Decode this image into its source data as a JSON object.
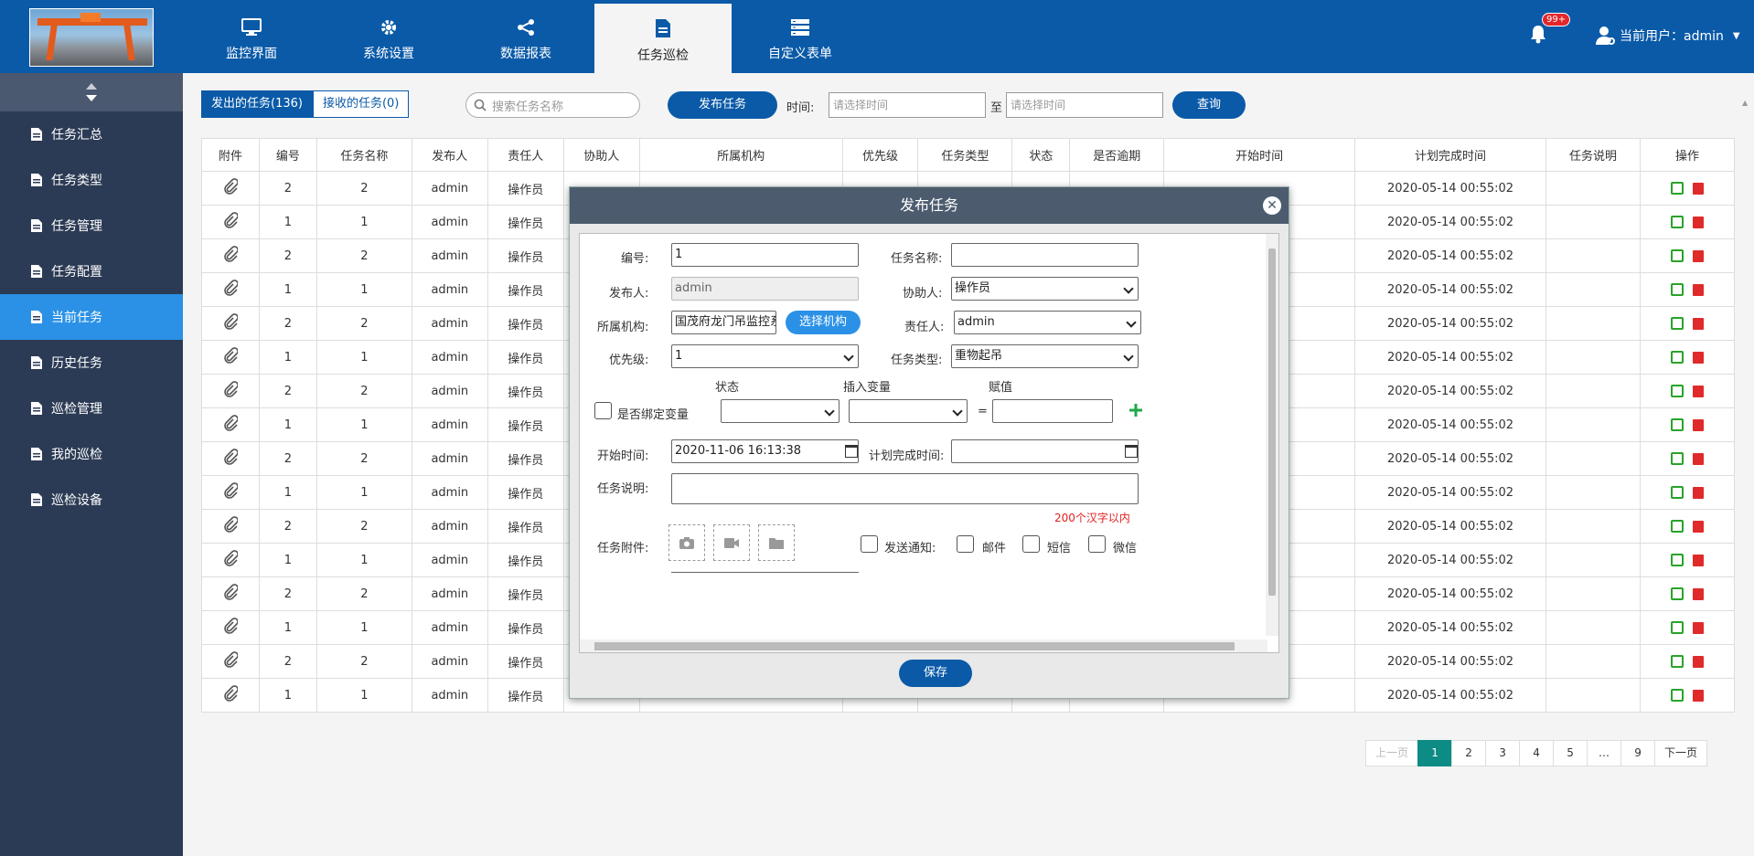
{
  "header": {
    "nav": [
      {
        "label": "监控界面",
        "icon": "monitor-icon"
      },
      {
        "label": "系统设置",
        "icon": "gear-icon"
      },
      {
        "label": "数据报表",
        "icon": "share-icon"
      },
      {
        "label": "任务巡检",
        "icon": "document-icon",
        "active": true
      },
      {
        "label": "自定义表单",
        "icon": "form-icon"
      }
    ],
    "badge": "99+",
    "user_label": "当前用户：admin"
  },
  "sidebar": {
    "items": [
      {
        "label": "任务汇总"
      },
      {
        "label": "任务类型"
      },
      {
        "label": "任务管理"
      },
      {
        "label": "任务配置"
      },
      {
        "label": "当前任务",
        "active": true
      },
      {
        "label": "历史任务"
      },
      {
        "label": "巡检管理"
      },
      {
        "label": "我的巡检"
      },
      {
        "label": "巡检设备"
      }
    ]
  },
  "toolbar": {
    "tab_sent": "发出的任务(136)",
    "tab_received": "接收的任务(0)",
    "search_placeholder": "搜索任务名称",
    "publish_label": "发布任务",
    "time_label": "时间:",
    "start_placeholder": "请选择时间",
    "to_label": "至",
    "end_placeholder": "请选择时间",
    "query_label": "查询"
  },
  "table": {
    "columns": [
      "附件",
      "编号",
      "任务名称",
      "发布人",
      "责任人",
      "协助人",
      "所属机构",
      "优先级",
      "任务类型",
      "状态",
      "是否逾期",
      "开始时间",
      "计划完成时间",
      "任务说明",
      "操作"
    ],
    "rows": [
      {
        "id": "2",
        "name": "2",
        "publisher": "admin",
        "owner": "操作员",
        "end": "2020-05-14 00:55:02"
      },
      {
        "id": "1",
        "name": "1",
        "publisher": "admin",
        "owner": "操作员",
        "end": "2020-05-14 00:55:02"
      },
      {
        "id": "2",
        "name": "2",
        "publisher": "admin",
        "owner": "操作员",
        "end": "2020-05-14 00:55:02"
      },
      {
        "id": "1",
        "name": "1",
        "publisher": "admin",
        "owner": "操作员",
        "end": "2020-05-14 00:55:02"
      },
      {
        "id": "2",
        "name": "2",
        "publisher": "admin",
        "owner": "操作员",
        "end": "2020-05-14 00:55:02"
      },
      {
        "id": "1",
        "name": "1",
        "publisher": "admin",
        "owner": "操作员",
        "end": "2020-05-14 00:55:02"
      },
      {
        "id": "2",
        "name": "2",
        "publisher": "admin",
        "owner": "操作员",
        "end": "2020-05-14 00:55:02"
      },
      {
        "id": "1",
        "name": "1",
        "publisher": "admin",
        "owner": "操作员",
        "end": "2020-05-14 00:55:02"
      },
      {
        "id": "2",
        "name": "2",
        "publisher": "admin",
        "owner": "操作员",
        "end": "2020-05-14 00:55:02"
      },
      {
        "id": "1",
        "name": "1",
        "publisher": "admin",
        "owner": "操作员",
        "end": "2020-05-14 00:55:02"
      },
      {
        "id": "2",
        "name": "2",
        "publisher": "admin",
        "owner": "操作员",
        "end": "2020-05-14 00:55:02"
      },
      {
        "id": "1",
        "name": "1",
        "publisher": "admin",
        "owner": "操作员",
        "end": "2020-05-14 00:55:02"
      },
      {
        "id": "2",
        "name": "2",
        "publisher": "admin",
        "owner": "操作员",
        "end": "2020-05-14 00:55:02"
      },
      {
        "id": "1",
        "name": "1",
        "publisher": "admin",
        "owner": "操作员",
        "end": "2020-05-14 00:55:02"
      },
      {
        "id": "2",
        "name": "2",
        "publisher": "admin",
        "owner": "操作员",
        "end": "2020-05-14 00:55:02"
      },
      {
        "id": "1",
        "name": "1",
        "publisher": "admin",
        "owner": "操作员",
        "end": "2020-05-14 00:55:02"
      }
    ]
  },
  "pagination": {
    "prev": "上一页",
    "pages": [
      "1",
      "2",
      "3",
      "4",
      "5",
      "…",
      "9"
    ],
    "current": "1",
    "next": "下一页"
  },
  "dialog": {
    "title": "发布任务",
    "close_icon": "close-icon",
    "fields": {
      "id_label": "编号:",
      "id_value": "1",
      "name_label": "任务名称:",
      "name_value": "",
      "publisher_label": "发布人:",
      "publisher_value": "admin",
      "assist_label": "协助人:",
      "assist_value": "操作员",
      "org_label": "所属机构:",
      "org_value": "国茂府龙门吊监控系统",
      "choose_org": "选择机构",
      "owner_label": "责任人:",
      "owner_value": "admin",
      "priority_label": "优先级:",
      "priority_value": "1",
      "type_label": "任务类型:",
      "type_value": "重物起吊",
      "col_state": "状态",
      "col_var": "插入变量",
      "col_assign": "赋值",
      "bind_label": "是否绑定变量",
      "eq": "=",
      "start_label": "开始时间:",
      "start_value": "2020-11-06 16:13:38",
      "plan_label": "计划完成时间:",
      "plan_value": "",
      "desc_label": "任务说明:",
      "desc_hint": "200个汉字以内",
      "attach_label": "任务附件:",
      "notify_label": "发送通知:",
      "mail_label": "邮件",
      "sms_label": "短信",
      "wechat_label": "微信"
    },
    "save_label": "保存"
  },
  "colors": {
    "primary": "#0a5aa8",
    "sidebar": "#2c3b55",
    "active_blue": "#2a91e6",
    "pager_active": "#0c8c84"
  }
}
